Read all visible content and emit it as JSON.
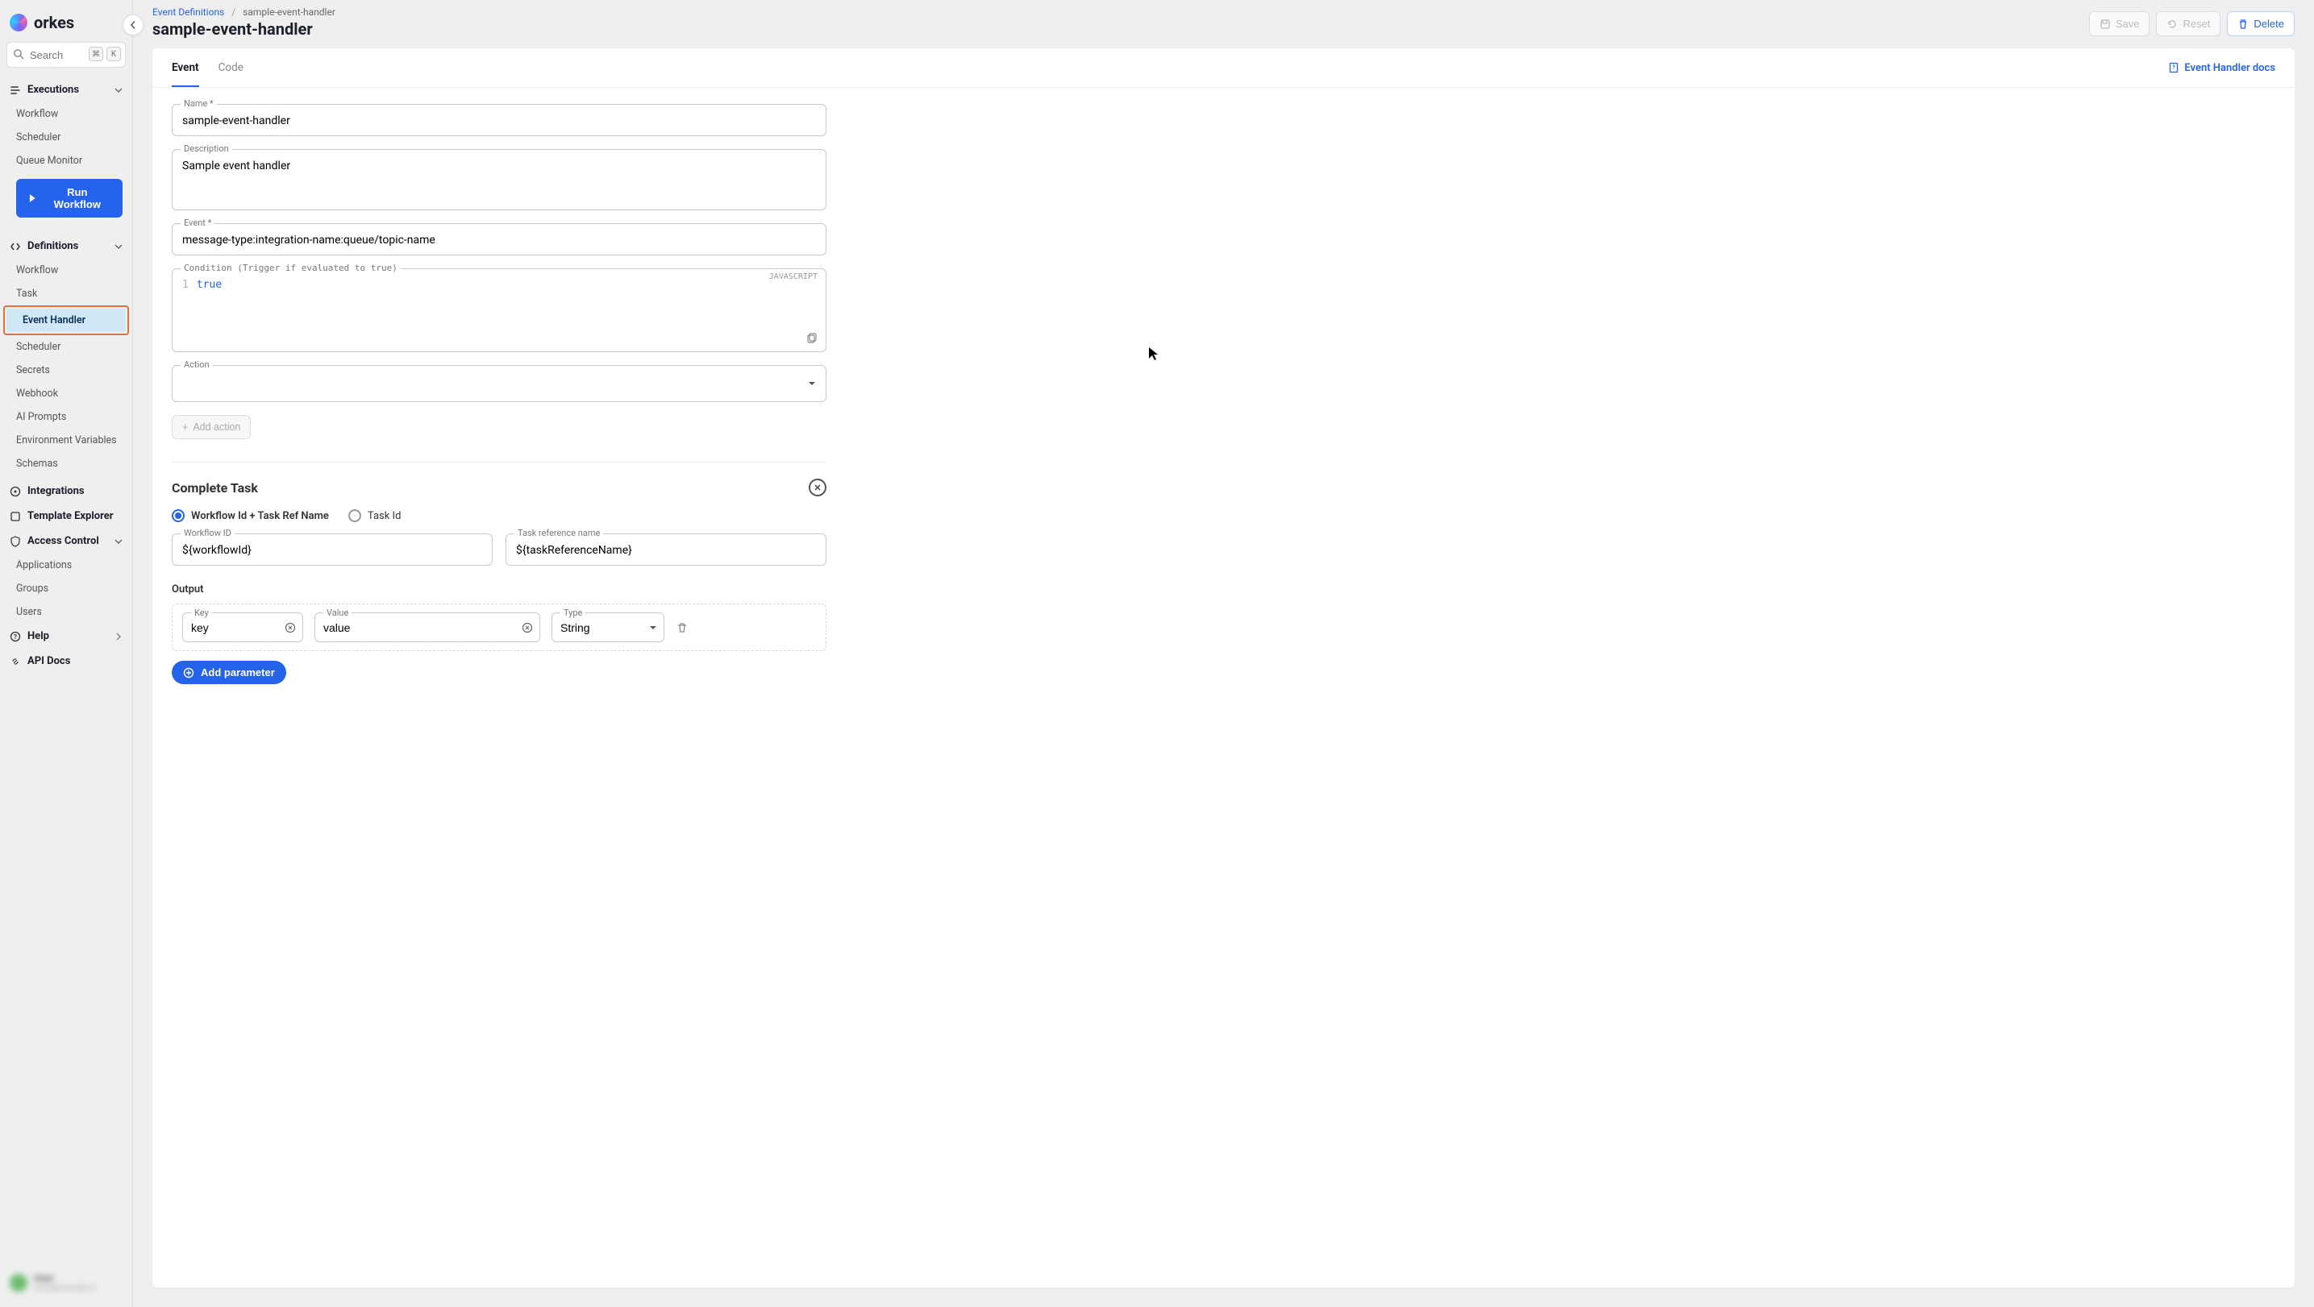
{
  "brand": "orkes",
  "search": {
    "placeholder": "Search",
    "kbd1": "⌘",
    "kbd2": "K"
  },
  "sidebar": {
    "executions": {
      "label": "Executions",
      "items": [
        "Workflow",
        "Scheduler",
        "Queue Monitor"
      ],
      "run_btn": "Run Workflow"
    },
    "definitions": {
      "label": "Definitions",
      "items": [
        "Workflow",
        "Task",
        "Event Handler",
        "Scheduler",
        "Secrets",
        "Webhook",
        "AI Prompts",
        "Environment Variables",
        "Schemas"
      ]
    },
    "integrations": "Integrations",
    "template_explorer": "Template Explorer",
    "access_control": {
      "label": "Access Control",
      "items": [
        "Applications",
        "Groups",
        "Users"
      ]
    },
    "help": "Help",
    "api_docs": "API Docs"
  },
  "user": {
    "name": "User",
    "sub": "user@example.io"
  },
  "breadcrumb": {
    "root": "Event Definitions",
    "sep": "/",
    "leaf": "sample-event-handler"
  },
  "page_title": "sample-event-handler",
  "actions": {
    "save": "Save",
    "reset": "Reset",
    "delete": "Delete"
  },
  "tabs": {
    "event": "Event",
    "code": "Code"
  },
  "docs_link": "Event Handler docs",
  "form": {
    "name_label": "Name *",
    "name_value": "sample-event-handler",
    "desc_label": "Description",
    "desc_value": "Sample event handler",
    "event_label": "Event *",
    "event_value": "message-type:integration-name:queue/topic-name",
    "cond_label": "Condition (Trigger if evaluated to true)",
    "cond_lang": "JAVASCRIPT",
    "cond_lineno": "1",
    "cond_code": "true",
    "action_label": "Action",
    "add_action": "Add action"
  },
  "complete_task": {
    "title": "Complete Task",
    "radio1": "Workflow Id + Task Ref Name",
    "radio2": "Task Id",
    "wfid_label": "Workflow ID",
    "wfid_value": "${workflowId}",
    "tref_label": "Task reference name",
    "tref_value": "${taskReferenceName}",
    "output_label": "Output",
    "key_label": "Key",
    "key_value": "key",
    "val_label": "Value",
    "val_value": "value",
    "type_label": "Type",
    "type_value": "String",
    "add_param": "Add parameter"
  }
}
